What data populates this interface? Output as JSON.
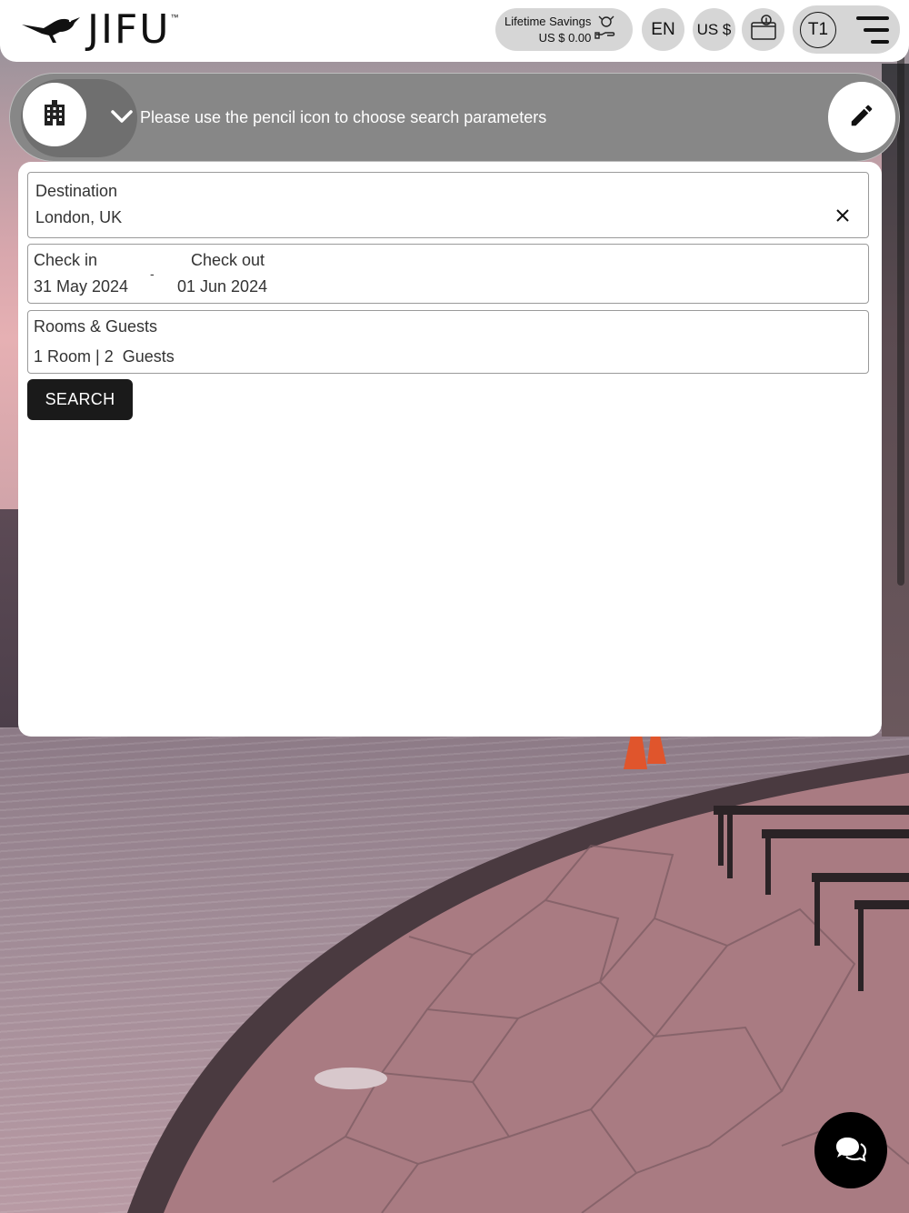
{
  "header": {
    "brand": "JIFU",
    "brand_tm": "™",
    "savings": {
      "label": "Lifetime Savings",
      "value": "US $ 0.00"
    },
    "language": "EN",
    "currency": "US $",
    "account_initials": "T1"
  },
  "search_bar": {
    "hint": "Please use the pencil icon to choose search parameters",
    "property_icon": "hotel-building-icon",
    "edit_icon": "pencil-icon"
  },
  "form": {
    "destination": {
      "label": "Destination",
      "value": "London, UK"
    },
    "check_in": {
      "label": "Check in",
      "value": "31 May 2024"
    },
    "check_out": {
      "label": "Check out",
      "value": "01 Jun 2024"
    },
    "date_separator": "-",
    "rooms_guests": {
      "label": "Rooms & Guests",
      "value": "1 Room | 2  Guests"
    },
    "search_button": "SEARCH"
  },
  "icons": [
    "roadrunner-logo",
    "savings-hand-icon",
    "wallet-icon",
    "hamburger-menu-icon",
    "chevron-down-icon",
    "close-icon",
    "chat-icon"
  ],
  "colors": {
    "accent": "#1a1a1a",
    "search_bar": "#878787",
    "pill": "#d6d6d6"
  }
}
